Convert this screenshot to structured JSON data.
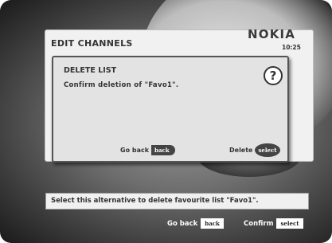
{
  "brand": {
    "name": "NOKIA"
  },
  "clock": {
    "time": "10:25"
  },
  "screen": {
    "title": "EDIT CHANNELS"
  },
  "dialog": {
    "title": "DELETE LIST",
    "message": "Confirm deletion of \"Favo1\".",
    "help_icon": "?",
    "back_label": "Go back",
    "back_key": "back",
    "delete_label": "Delete",
    "delete_key": "select"
  },
  "info_bar": {
    "text": "Select this alternative to delete favourite list \"Favo1\"."
  },
  "footer": {
    "back_label": "Go back",
    "back_key": "back",
    "confirm_label": "Confirm",
    "confirm_key": "select"
  },
  "colors": {
    "panel": "#f1f1f1",
    "dialog": "#e3e3e3",
    "text": "#333333",
    "key": "#444444"
  },
  "icons": [
    "help-icon",
    "back-key-icon",
    "select-key-icon"
  ]
}
